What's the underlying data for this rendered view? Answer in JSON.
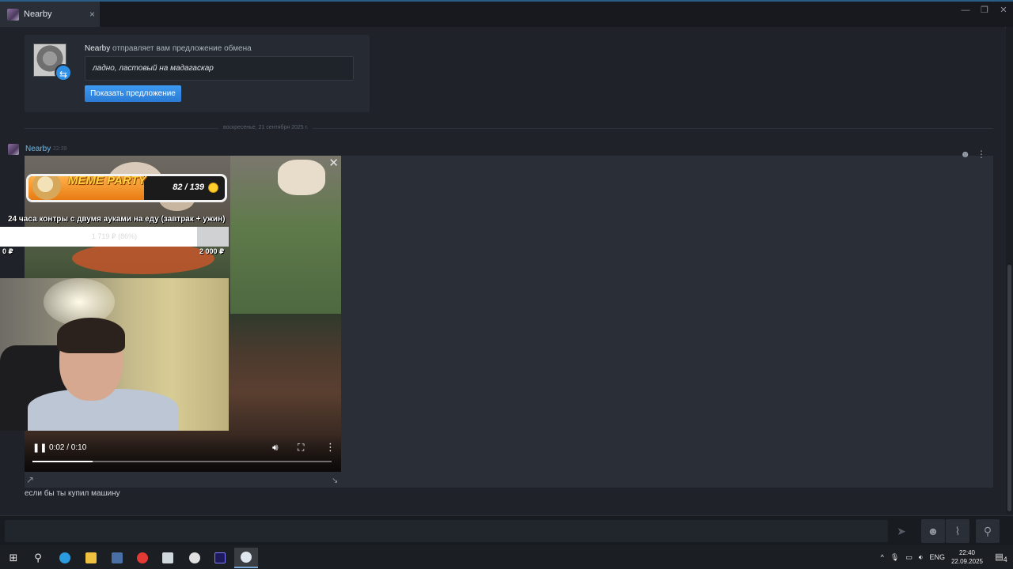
{
  "window": {
    "tab_title": "Nearby",
    "close_glyph": "×",
    "controls": [
      "—",
      "❐",
      "✕"
    ]
  },
  "trade": {
    "sender": "Nearby",
    "action": " отправляет вам предложение обмена",
    "message": "ладно, ластовый на мадагаскар",
    "button": "Показать предложение",
    "badge_icon": "trade-arrows-icon"
  },
  "divider": {
    "text": "воскресенье, 21 сентября 2025 г."
  },
  "message": {
    "author": "Nearby",
    "time": "22:39",
    "text": "если бы ты купил машину"
  },
  "video": {
    "time": "0:02 / 0:10",
    "progress_fraction": 0.2
  },
  "overlay": {
    "meme_title": "MEME PARTY",
    "meme_count": "82 / 139",
    "meme_fraction": 0.59,
    "donation_title": "24 часа контры с двумя ауками на еду (завтрак + ужин)",
    "donation_amount": "1 719 ₽ (86%)",
    "donation_fraction": 0.86,
    "donation_min": "0 ₽",
    "donation_max": "2 000 ₽"
  },
  "taskbar": {
    "lang": "ENG",
    "time": "22:40",
    "date": "22.09.2025",
    "notifications": "4",
    "apps": [
      "windows-start",
      "search",
      "edge",
      "file-explorer",
      "calculator",
      "yandex",
      "app",
      "chrome-like",
      "audition",
      "steam"
    ]
  },
  "colors": {
    "accent": "#2f8fe6",
    "author": "#6fb7e8",
    "background": "#1f2329"
  }
}
